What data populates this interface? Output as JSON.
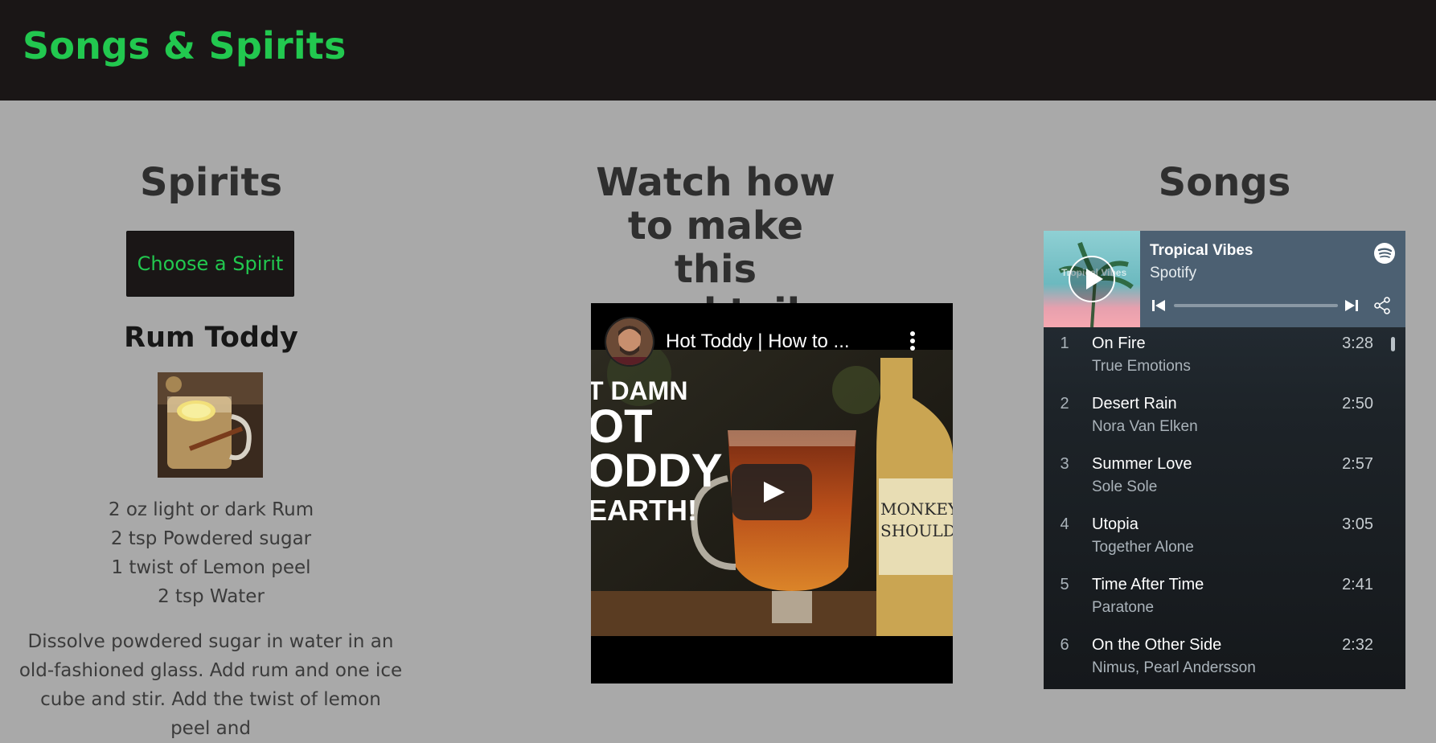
{
  "header": {
    "brand": "Songs & Spirits"
  },
  "spirits": {
    "title": "Spirits",
    "choose_label": "Choose a Spirit",
    "drink_name": "Rum Toddy",
    "ingredients": [
      "2 oz light or dark Rum",
      "2 tsp Powdered sugar",
      "1 twist of Lemon peel",
      "2 tsp Water"
    ],
    "instructions": "Dissolve powdered sugar in water in an old-fashioned glass. Add rum and one ice cube and stir. Add the twist of lemon peel and"
  },
  "video": {
    "heading": "Watch how to make this cocktail",
    "title": "Hot Toddy | How to ...",
    "thumb_text": [
      "T DAMN",
      "OT",
      "ODDY",
      "EARTH!"
    ],
    "bottle_label": [
      "MONKEY",
      "SHOULDE"
    ]
  },
  "songs": {
    "title": "Songs",
    "playlist": "Tropical Vibes",
    "owner": "Spotify",
    "cover_text": "Tropical Vibes",
    "progress_fraction": 0,
    "tracks": [
      {
        "num": "1",
        "name": "On Fire",
        "artist": "True Emotions",
        "duration": "3:28"
      },
      {
        "num": "2",
        "name": "Desert Rain",
        "artist": "Nora Van Elken",
        "duration": "2:50"
      },
      {
        "num": "3",
        "name": "Summer Love",
        "artist": "Sole Sole",
        "duration": "2:57"
      },
      {
        "num": "4",
        "name": "Utopia",
        "artist": "Together Alone",
        "duration": "3:05"
      },
      {
        "num": "5",
        "name": "Time After Time",
        "artist": "Paratone",
        "duration": "2:41"
      },
      {
        "num": "6",
        "name": "On the Other Side",
        "artist": "Nimus, Pearl Andersson",
        "duration": "2:32"
      }
    ]
  },
  "colors": {
    "accent": "#22c84f",
    "header_bg": "#1a1616",
    "page_bg": "#a9a9a9"
  }
}
